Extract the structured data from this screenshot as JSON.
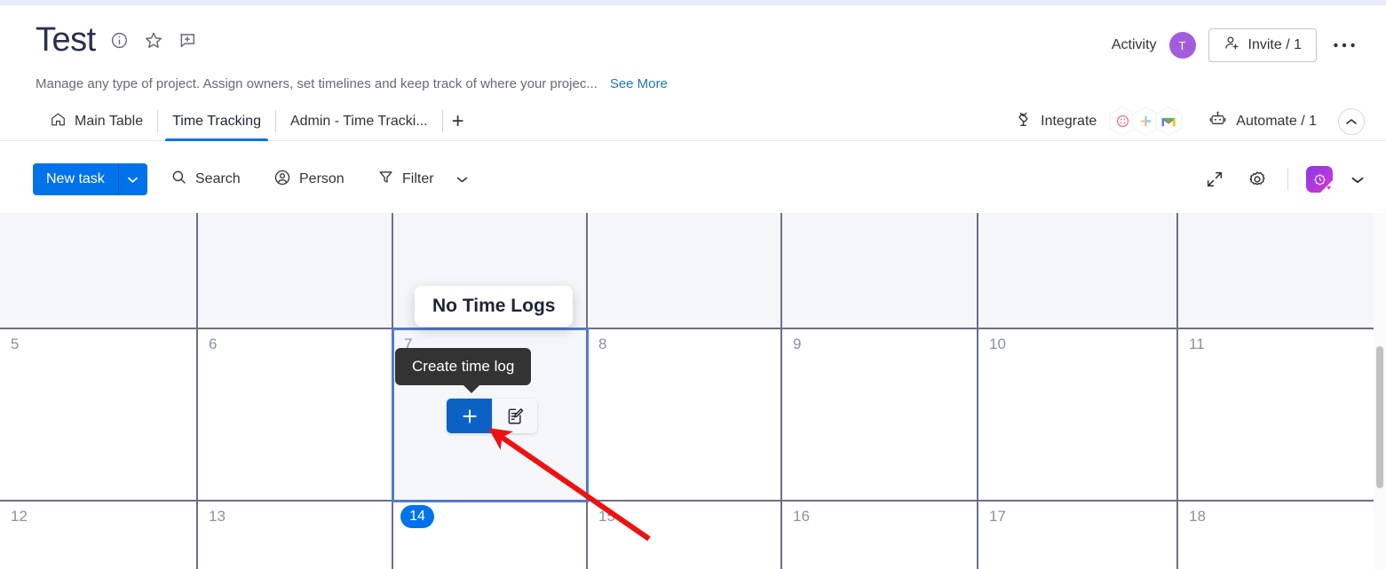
{
  "header": {
    "board_title": "Test",
    "description": "Manage any type of project. Assign owners, set timelines and keep track of where your projec...",
    "see_more": "See More",
    "activity_label": "Activity",
    "avatar_initial": "T",
    "invite_label": "Invite / 1",
    "icons": [
      "info-icon",
      "star-icon",
      "add-comment-icon",
      "more-options-icon"
    ]
  },
  "tabs": {
    "items": [
      {
        "label": "Main Table",
        "icon": "home-icon",
        "active": false
      },
      {
        "label": "Time Tracking",
        "icon": "",
        "active": true
      },
      {
        "label": "Admin - Time Tracki...",
        "icon": "",
        "active": false
      }
    ],
    "add_label": "+",
    "integrate_label": "Integrate",
    "integration_apps": [
      "dialpad-icon",
      "slack-icon",
      "gmail-icon"
    ],
    "automate_label": "Automate / 1",
    "collapse_icon": "chevron-up-icon"
  },
  "toolbar": {
    "new_task_label": "New task",
    "new_task_caret": "chevron-down-icon",
    "search_label": "Search",
    "person_label": "Person",
    "filter_label": "Filter",
    "filter_caret": "chevron-down-icon",
    "expand_icon": "expand-icon",
    "settings_icon": "gear-icon",
    "widget_icon": "time-tracking-widget-icon",
    "widget_caret": "chevron-down-icon"
  },
  "calendar": {
    "rows": [
      {
        "shaded": true,
        "days": [
          "",
          "",
          "",
          "",
          "",
          "",
          ""
        ]
      },
      {
        "shaded": false,
        "days": [
          "5",
          "6",
          "7",
          "8",
          "9",
          "10",
          "11"
        ]
      },
      {
        "shaded": false,
        "days": [
          "12",
          "13",
          "14",
          "15",
          "16",
          "17",
          "18"
        ]
      }
    ],
    "selected_day": "7",
    "today_day": "14"
  },
  "overlays": {
    "no_time_logs": "No Time Logs",
    "create_time_log": "Create time log",
    "plus_button": "plus-icon",
    "edit_button": "edit-note-icon"
  },
  "colors": {
    "primary_blue": "#0073ea",
    "button_blue": "#0b62c4",
    "avatar_purple": "#a25ddc",
    "link_blue": "#1f76c2",
    "tooltip_dark": "#333333",
    "arrow_red": "#ee1111",
    "grid_line": "#6b7084",
    "shaded_cell": "#f4f6fa"
  }
}
